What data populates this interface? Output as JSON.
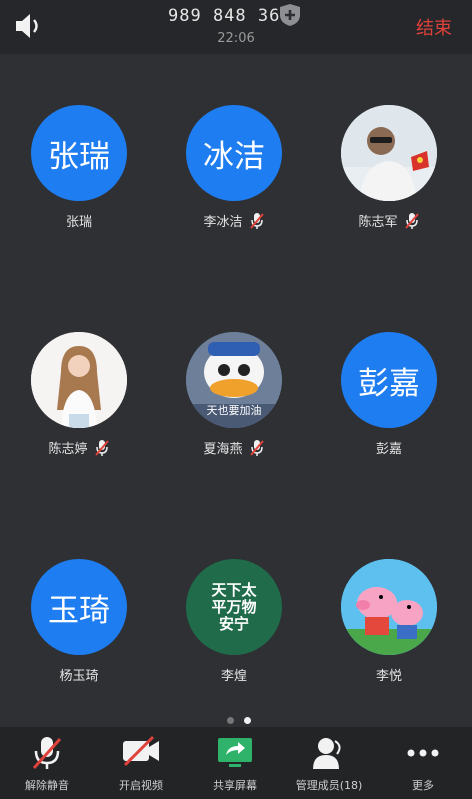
{
  "header": {
    "meeting_id": "989 848 368",
    "time": "22:06",
    "end_label": "结束"
  },
  "participants": [
    {
      "avatar_text": "张瑞",
      "name": "张瑞",
      "muted": false,
      "avatar_type": "text"
    },
    {
      "avatar_text": "冰洁",
      "name": "李冰洁",
      "muted": true,
      "avatar_type": "text"
    },
    {
      "avatar_text": "",
      "name": "陈志军",
      "muted": true,
      "avatar_type": "photo-man"
    },
    {
      "avatar_text": "",
      "name": "陈志婷",
      "muted": true,
      "avatar_type": "photo-woman"
    },
    {
      "avatar_text": "天也要加油",
      "name": "夏海燕",
      "muted": true,
      "avatar_type": "photo-duck"
    },
    {
      "avatar_text": "彭嘉",
      "name": "彭嘉",
      "muted": false,
      "avatar_type": "text"
    },
    {
      "avatar_text": "玉琦",
      "name": "杨玉琦",
      "muted": false,
      "avatar_type": "text"
    },
    {
      "avatar_text": "天下太平万物安宁",
      "name": "李煌",
      "muted": false,
      "avatar_type": "calligraphy"
    },
    {
      "avatar_text": "",
      "name": "李悦",
      "muted": false,
      "avatar_type": "photo-pig"
    }
  ],
  "pager": {
    "pages": 2,
    "current": 2
  },
  "toolbar": {
    "unmute": "解除静音",
    "video": "开启视频",
    "share": "共享屏幕",
    "members": "管理成员(18)",
    "more": "更多"
  },
  "colors": {
    "accent": "#1f7df2",
    "end": "#e0413a",
    "share": "#2fb36a"
  }
}
